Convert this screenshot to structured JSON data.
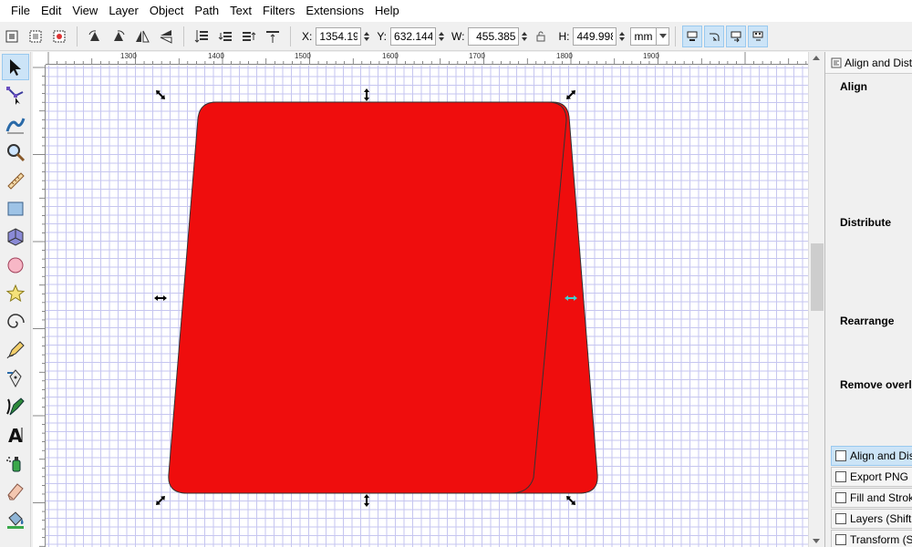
{
  "menu": [
    {
      "label": "File",
      "key": "F"
    },
    {
      "label": "Edit",
      "key": "E"
    },
    {
      "label": "View",
      "key": "V"
    },
    {
      "label": "Layer",
      "key": "L"
    },
    {
      "label": "Object",
      "key": "O"
    },
    {
      "label": "Path",
      "key": "P"
    },
    {
      "label": "Text",
      "key": "T"
    },
    {
      "label": "Filters",
      "key": "r"
    },
    {
      "label": "Extensions",
      "key": "x"
    },
    {
      "label": "Help",
      "key": "H"
    }
  ],
  "controls": {
    "x_label": "X:",
    "x_value": "1354.19",
    "y_label": "Y:",
    "y_value": "632.144",
    "w_label": "W:",
    "w_value": "455.385",
    "h_label": "H:",
    "h_value": "449.998",
    "unit": "mm"
  },
  "ruler": {
    "labels": [
      "1300",
      "1400",
      "1500",
      "1600",
      "1700",
      "1800",
      "1900"
    ]
  },
  "dock": {
    "title": "Align and Distr",
    "sections": [
      "Align",
      "Distribute",
      "Rearrange",
      "Remove overl"
    ],
    "tabs": [
      {
        "label": "Align and Dis",
        "active": true
      },
      {
        "label": "Export PNG I",
        "active": false
      },
      {
        "label": "Fill and Strok",
        "active": false
      },
      {
        "label": "Layers (Shift-",
        "active": false
      },
      {
        "label": "Transform (S",
        "active": false
      }
    ]
  },
  "colors": {
    "shape_fill": "#ef0d0d",
    "accent": "#cce4f7",
    "grid": "#c6c6f0",
    "handle": "#000000",
    "rotation_handle": "#3fd0d0"
  },
  "icons": {
    "tools": [
      "selector-tool-icon",
      "node-tool-icon",
      "tweak-tool-icon",
      "zoom-tool-icon",
      "measure-tool-icon",
      "rectangle-tool-icon",
      "3d-box-tool-icon",
      "ellipse-tool-icon",
      "star-tool-icon",
      "spiral-tool-icon",
      "pencil-tool-icon",
      "pen-tool-icon",
      "calligraphy-tool-icon",
      "text-tool-icon",
      "spray-tool-icon",
      "eraser-tool-icon",
      "paint-bucket-tool-icon"
    ]
  }
}
